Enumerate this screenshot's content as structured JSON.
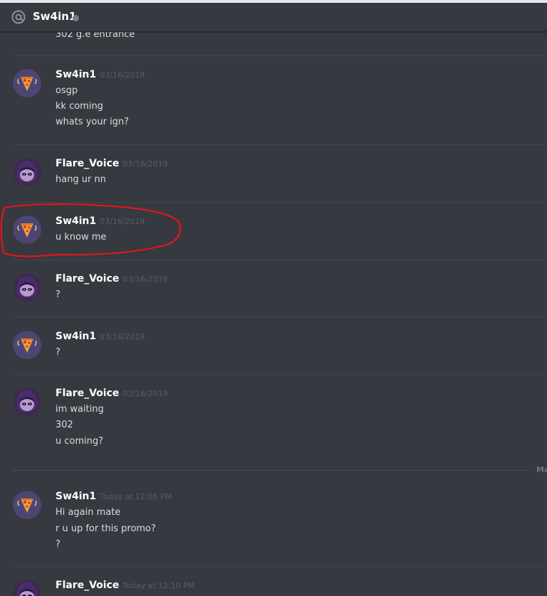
{
  "header": {
    "channel_name": "Sw4in1",
    "icon": "at-icon",
    "status": "offline"
  },
  "previous_message_tail": "302 g.e entrance",
  "date_separator": "Ma",
  "messages": [
    {
      "author": "Sw4in1",
      "timestamp": "03/16/2019",
      "avatar": "pizza-avatar",
      "lines": [
        "osgp",
        "kk coming",
        "whats your ign?"
      ]
    },
    {
      "author": "Flare_Voice",
      "timestamp": "03/16/2019",
      "avatar": "purple-character-avatar",
      "lines": [
        "hang ur nn"
      ]
    },
    {
      "author": "Sw4in1",
      "timestamp": "03/16/2019",
      "avatar": "pizza-avatar",
      "lines": [
        "u know me"
      ]
    },
    {
      "author": "Flare_Voice",
      "timestamp": "03/16/2019",
      "avatar": "purple-character-avatar",
      "lines": [
        "?"
      ]
    },
    {
      "author": "Sw4in1",
      "timestamp": "03/16/2019",
      "avatar": "pizza-avatar",
      "lines": [
        "?"
      ]
    },
    {
      "author": "Flare_Voice",
      "timestamp": "03/16/2019",
      "avatar": "purple-character-avatar",
      "lines": [
        "im waiting",
        "302",
        "u coming?"
      ]
    },
    {
      "author": "Sw4in1",
      "timestamp": "Today at 12:05 PM",
      "avatar": "pizza-avatar",
      "lines": [
        "Hi again mate",
        "r u up for this promo?",
        "?"
      ]
    },
    {
      "author": "Flare_Voice",
      "timestamp": "Today at 12:10 PM",
      "avatar": "purple-character-avatar",
      "lines": []
    }
  ],
  "colors": {
    "background": "#36393f",
    "username": "#ffffff",
    "message_text": "#dcddde",
    "timestamp": "#5a5d63",
    "annotation_circle": "#e0161e"
  }
}
